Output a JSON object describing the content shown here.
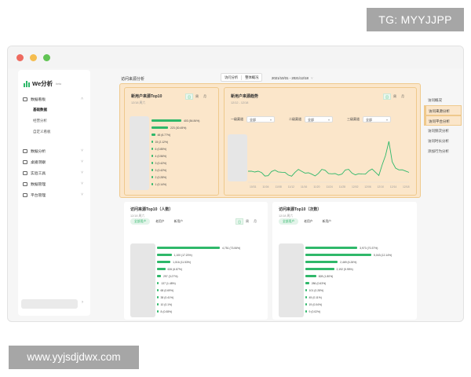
{
  "overlay": {
    "tg": "TG: MYYJJPP",
    "watermark": "www.yyjsdjdwx.com"
  },
  "app": {
    "name": "We分析",
    "sub": "beta"
  },
  "sidebar": {
    "items": [
      {
        "label": "数据看板"
      },
      {
        "label": "基础数据",
        "sub": true,
        "active": true
      },
      {
        "label": "经营分析",
        "sub": true
      },
      {
        "label": "自定义看板",
        "sub": true
      },
      {
        "label": "数据分析"
      },
      {
        "label": "桌播洞察"
      },
      {
        "label": "实验工具"
      },
      {
        "label": "数据管理"
      },
      {
        "label": "平台管理"
      }
    ]
  },
  "main": {
    "title": "访问来源分析",
    "segment": [
      "访问分析",
      "整体概况"
    ],
    "date_from": "2021/10/31",
    "date_sep": "-",
    "date_to": "2021/12/18"
  },
  "top10_new": {
    "title": "新用户来源Top10",
    "sub": "12/18 周六",
    "tabs": [
      "日",
      "周",
      "月"
    ],
    "rows": [
      {
        "label": "403 (54.84%)",
        "value": 403
      },
      {
        "label": "223 (30.45%)",
        "value": 223
      },
      {
        "label": "48 (6.77%)",
        "value": 48
      },
      {
        "label": "15 (2.12%)",
        "value": 15
      },
      {
        "label": "6 (0.85%)",
        "value": 6
      },
      {
        "label": "4 (0.56%)",
        "value": 4
      },
      {
        "label": "3 (0.42%)",
        "value": 3
      },
      {
        "label": "3 (0.42%)",
        "value": 3
      },
      {
        "label": "2 (0.28%)",
        "value": 2
      },
      {
        "label": "1 (0.14%)",
        "value": 1
      }
    ]
  },
  "trend": {
    "title": "新用户来源趋势",
    "sub": "12/12 - 12/18",
    "tabs": [
      "日",
      "周",
      "月"
    ],
    "filters": [
      {
        "label": "一级渠道",
        "value": "全部"
      },
      {
        "label": "二级渠道",
        "value": "全部"
      },
      {
        "label": "三级渠道",
        "value": "全部"
      }
    ],
    "x_labels": [
      "10/31",
      "11/04",
      "11/08",
      "11/12",
      "11/16",
      "11/20",
      "11/24",
      "11/28",
      "12/02",
      "12/06",
      "12/10",
      "12/14",
      "12/18"
    ]
  },
  "top10_people": {
    "title": "访问来源Top10（人数）",
    "sub": "12/18 周六",
    "pills": [
      "全部用户",
      "老用户",
      "新用户"
    ],
    "tabs": [
      "日",
      "周",
      "月"
    ],
    "rows": [
      {
        "label": "4,751 (73.06%)",
        "value": 4751
      },
      {
        "label": "1,100 (17.20%)",
        "value": 1100
      },
      {
        "label": "1,016 (11.53%)",
        "value": 1016
      },
      {
        "label": "626 (6.87%)",
        "value": 626
      },
      {
        "label": "297 (3.27%)",
        "value": 297
      },
      {
        "label": "137 (1.48%)",
        "value": 137
      },
      {
        "label": "68 (0.69%)",
        "value": 68
      },
      {
        "label": "38 (0.41%)",
        "value": 38
      },
      {
        "label": "10 (0.1%)",
        "value": 10
      },
      {
        "label": "8 (0.08%)",
        "value": 8
      }
    ]
  },
  "top10_times": {
    "title": "访问来源Top10（次数）",
    "sub": "12/18 周六",
    "pills": [
      "全部用户",
      "老用户",
      "新用户"
    ],
    "tabs": [
      "日",
      "周",
      "月"
    ],
    "rows": [
      {
        "label": "3,973 (70.37%)",
        "value": 3973
      },
      {
        "label": "5,043 (12.14%)",
        "value": 5043
      },
      {
        "label": "2,469 (6.26%)",
        "value": 2469
      },
      {
        "label": "2,192 (5.95%)",
        "value": 2192
      },
      {
        "label": "828 (1.80%)",
        "value": 828
      },
      {
        "label": "286 (0.63%)",
        "value": 286
      },
      {
        "label": "101 (0.28%)",
        "value": 101
      },
      {
        "label": "45 (0.11%)",
        "value": 45
      },
      {
        "label": "19 (0.04%)",
        "value": 19
      },
      {
        "label": "9 (0.02%)",
        "value": 9
      }
    ]
  },
  "right_nav": {
    "items": [
      {
        "label": "访问概况"
      },
      {
        "label": "访问来源分析"
      },
      {
        "label": "访问平台分析",
        "active": true
      },
      {
        "label": "访问频次分析"
      },
      {
        "label": "访问时长分析"
      },
      {
        "label": "添加行为分析"
      }
    ]
  },
  "colors": {
    "accent": "#2fb86a",
    "highlight": "#fbe6ca",
    "highlight_border": "#efc98c"
  }
}
